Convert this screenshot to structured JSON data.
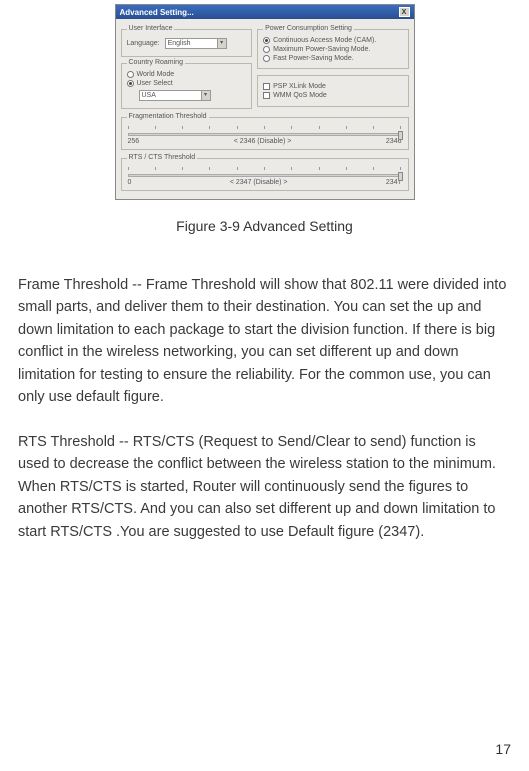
{
  "dialog": {
    "title": "Advanced Setting...",
    "close": "X",
    "user_interface": {
      "group_title": "User Interface",
      "language_label": "Language:",
      "language_value": "English"
    },
    "country_roaming": {
      "group_title": "Country Roaming",
      "world_mode": "World Mode",
      "user_select": "User Select",
      "country_value": "USA"
    },
    "power": {
      "group_title": "Power Consumption Setting",
      "cam": "Continuous Access Mode (CAM).",
      "max": "Maximum Power-Saving Mode.",
      "fast": "Fast Power-Saving Mode."
    },
    "modes": {
      "psp": "PSP XLink Mode",
      "wmm": "WMM QoS Mode"
    },
    "frag": {
      "group_title": "Fragmentation Threshold",
      "min": "256",
      "center": "< 2346 (Disable) >",
      "max": "2346"
    },
    "rts": {
      "group_title": "RTS / CTS Threshold",
      "min": "0",
      "center": "< 2347 (Disable) >",
      "max": "2347"
    }
  },
  "caption": "Figure 3-9 Advanced Setting",
  "para1": "Frame Threshold -- Frame Threshold will show that 802.11 were divided into small parts, and deliver them to their destination. You can set the up and down limitation to each package to start the division function. If there is big conflict in the wireless networking, you can set different up and down limitation for testing to ensure the reliability. For the common use, you can only use default figure.",
  "para2": "RTS Threshold -- RTS/CTS (Request to Send/Clear to send) function is used to decrease the conflict between the wireless station to the minimum. When RTS/CTS is started, Router will continuously send the figures to another RTS/CTS. And you can also set different up and down limitation to start RTS/CTS .You are suggested to use Default figure (2347).",
  "page_number": "17"
}
